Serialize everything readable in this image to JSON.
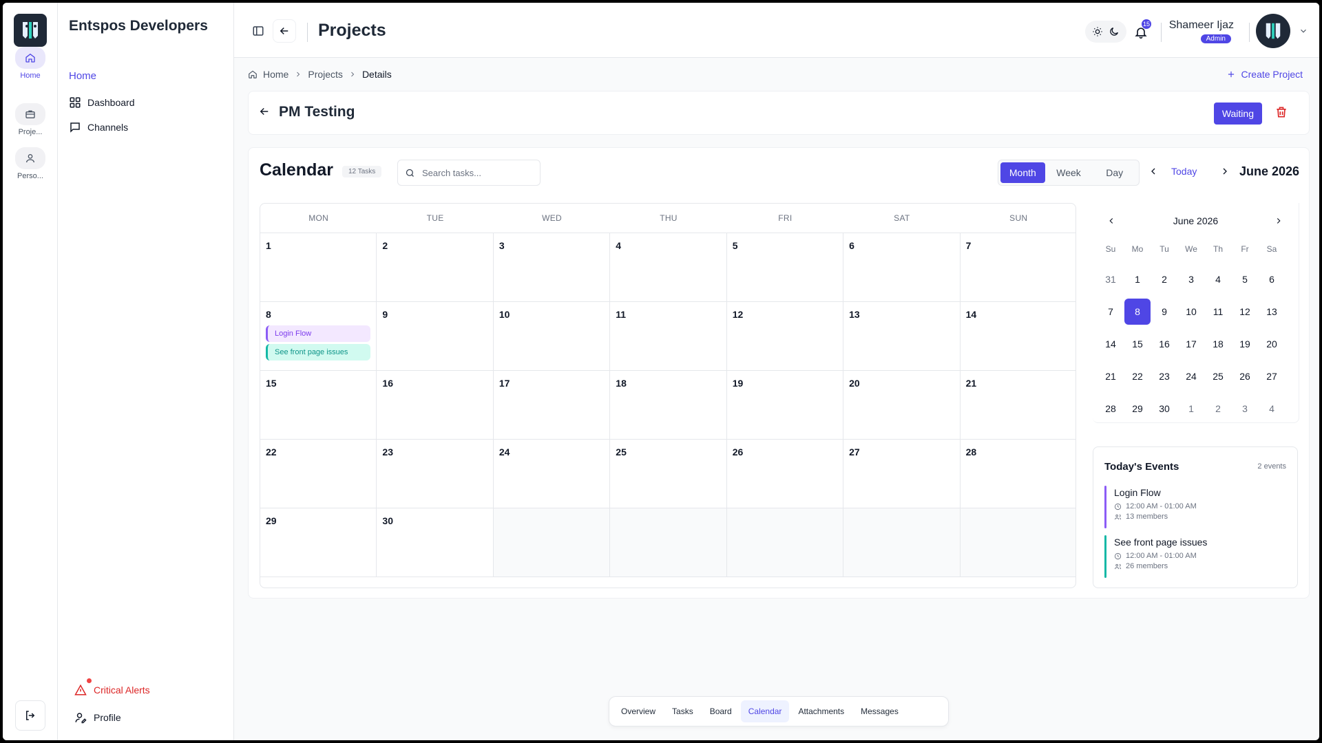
{
  "org_name": "Entspos Developers",
  "rail": [
    {
      "label": "Home",
      "icon": "home-icon",
      "active": true
    },
    {
      "label": "Proje...",
      "icon": "briefcase-icon",
      "active": false
    },
    {
      "label": "Perso...",
      "icon": "user-icon",
      "active": false
    }
  ],
  "sidebar": {
    "home": "Home",
    "items": [
      {
        "label": "Dashboard",
        "icon": "grid-icon"
      },
      {
        "label": "Channels",
        "icon": "chat-icon"
      }
    ],
    "alerts": "Critical Alerts",
    "profile": "Profile"
  },
  "header": {
    "title": "Projects",
    "notification_count": "15",
    "user_name": "Shameer Ijaz",
    "user_role": "Admin"
  },
  "breadcrumb": [
    "Home",
    "Projects",
    "Details"
  ],
  "create_project": "Create Project",
  "project": {
    "name": "PM Testing",
    "status": "Waiting"
  },
  "calendar": {
    "title": "Calendar",
    "task_count": "12 Tasks",
    "search_placeholder": "Search tasks...",
    "views": [
      "Month",
      "Week",
      "Day"
    ],
    "active_view": "Month",
    "today_label": "Today",
    "current_month": "June 2026",
    "weekdays": [
      "MON",
      "TUE",
      "WED",
      "THU",
      "FRI",
      "SAT",
      "SUN"
    ],
    "weeks": [
      [
        "1",
        "2",
        "3",
        "4",
        "5",
        "6",
        "7"
      ],
      [
        "8",
        "9",
        "10",
        "11",
        "12",
        "13",
        "14"
      ],
      [
        "15",
        "16",
        "17",
        "18",
        "19",
        "20",
        "21"
      ],
      [
        "22",
        "23",
        "24",
        "25",
        "26",
        "27",
        "28"
      ],
      [
        "29",
        "30",
        "",
        "",
        "",
        "",
        ""
      ]
    ],
    "events_on_8": [
      "Login Flow",
      "See front page issues"
    ]
  },
  "mini_calendar": {
    "title": "June 2026",
    "headers": [
      "Su",
      "Mo",
      "Tu",
      "We",
      "Th",
      "Fr",
      "Sa"
    ],
    "weeks": [
      [
        "31",
        "1",
        "2",
        "3",
        "4",
        "5",
        "6"
      ],
      [
        "7",
        "8",
        "9",
        "10",
        "11",
        "12",
        "13"
      ],
      [
        "14",
        "15",
        "16",
        "17",
        "18",
        "19",
        "20"
      ],
      [
        "21",
        "22",
        "23",
        "24",
        "25",
        "26",
        "27"
      ],
      [
        "28",
        "29",
        "30",
        "1",
        "2",
        "3",
        "4"
      ]
    ],
    "selected": "8"
  },
  "today_events": {
    "title": "Today's Events",
    "count": "2 events",
    "events": [
      {
        "name": "Login Flow",
        "time": "12:00 AM - 01:00 AM",
        "members": "13 members",
        "color": "#8b5cf6"
      },
      {
        "name": "See front page issues",
        "time": "12:00 AM - 01:00 AM",
        "members": "26 members",
        "color": "#14b8a6"
      }
    ]
  },
  "tabs": [
    "Overview",
    "Tasks",
    "Board",
    "Calendar",
    "Attachments",
    "Messages"
  ],
  "active_tab": "Calendar",
  "colors": {
    "accent": "#4f46e5",
    "danger": "#dc2626",
    "event_purple": "#8b5cf6",
    "event_teal": "#14b8a6"
  }
}
